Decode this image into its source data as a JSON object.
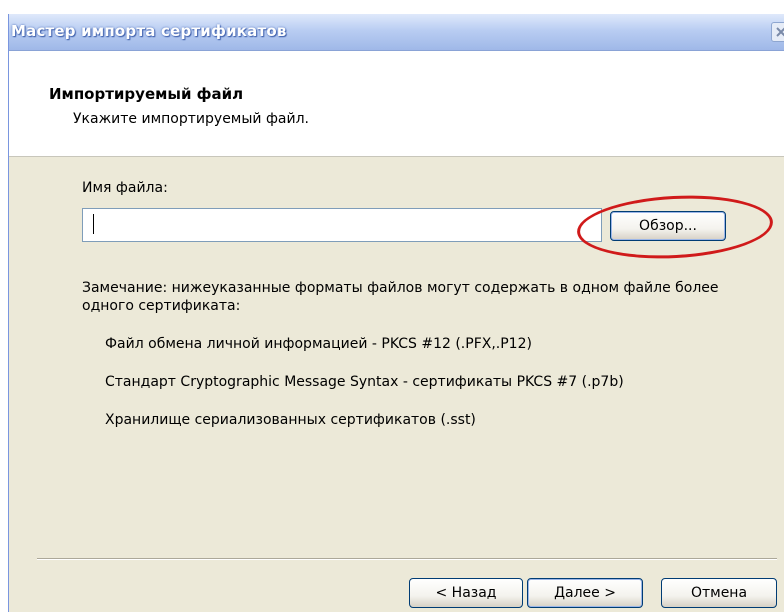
{
  "window": {
    "title": "Мастер импорта сертификатов"
  },
  "header": {
    "title": "Импортируемый файл",
    "subtitle": "Укажите импортируемый файл."
  },
  "form": {
    "filename_label": "Имя файла:",
    "filename_value": "",
    "browse_label": "Обзор..."
  },
  "note": {
    "line1": "Замечание: нижеуказанные форматы файлов могут содержать в одном файле более",
    "line2": "одного сертификата:",
    "formats": [
      "Файл обмена личной информацией - PKCS #12 (.PFX,.P12)",
      "Стандарт Cryptographic Message Syntax - сертификаты PKCS #7 (.p7b)",
      "Хранилище сериализованных сертификатов (.sst)"
    ]
  },
  "footer": {
    "back_label": "< Назад",
    "next_label": "Далее >",
    "cancel_label": "Отмена"
  },
  "colors": {
    "dialog_bg": "#ece9d8",
    "highlight": "#d01a1a"
  }
}
